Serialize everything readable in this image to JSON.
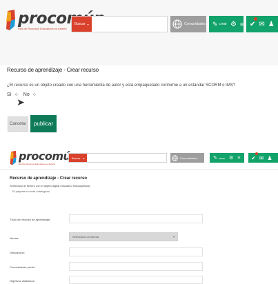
{
  "header": {
    "logo_text": "procomún",
    "logo_tagline": "Red de Recursos Educativos en Abierto",
    "search_category": "Buscar",
    "search_placeholder": "",
    "community_label": "Comunidades",
    "create_label": "crear",
    "colors": {
      "accent_red": "#d9412c",
      "green": "#12a36a",
      "gray_button": "#9e9e9e"
    }
  },
  "screen1": {
    "title": "Recurso de aprendizaje - Crear recurso",
    "description": "¿El recurso es un objeto creado con una herramienta de autor y está empaquetado conforme a un estándar SCORM o IMS?",
    "radio_yes": "Sí",
    "radio_no": "No",
    "cancel_label": "Cancelar",
    "publish_label": "publicar"
  },
  "screen2": {
    "title": "Recurso de aprendizaje - Crear recurso",
    "subtitle": "Selecciona el fichero con el objeto digital educativo empaquetado:",
    "note": "El paquete no está catalogado.",
    "fields": {
      "titulo_label": "Título del recurso de aprendizaje:",
      "idioma_label": "Idioma:",
      "idioma_select": "Selecciona un idioma",
      "descripcion_label": "Descripción:",
      "conocimiento_label": "Conocimiento previo:",
      "objetivos_label": "Objetivos didácticos:"
    }
  }
}
